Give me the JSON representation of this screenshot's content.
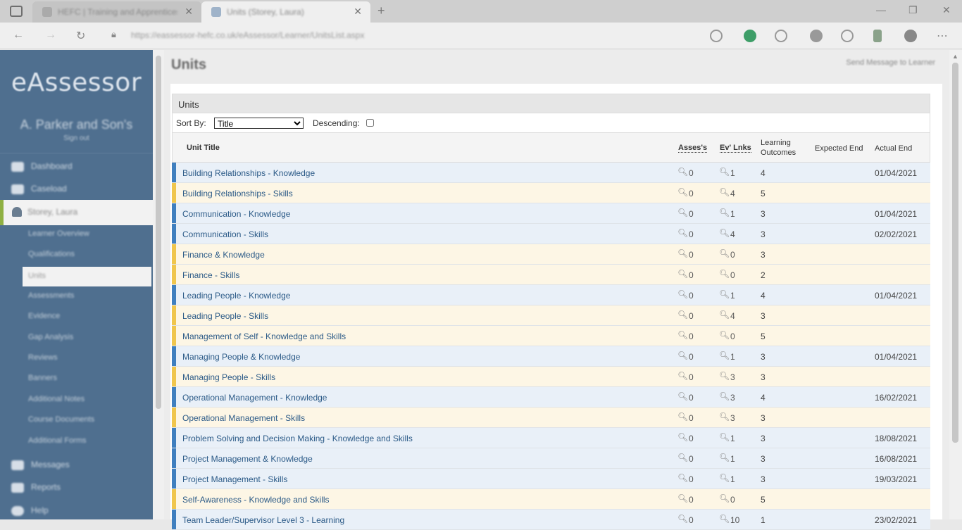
{
  "browser": {
    "tabs": [
      {
        "title": "HEFC | Training and Apprentices"
      },
      {
        "title": "Units (Storey, Laura)"
      }
    ],
    "url": "https://eassessor-hefc.co.uk/eAssessor/Learner/UnitsList.aspx"
  },
  "sidebar": {
    "brand": "eAssessor",
    "org": "A. Parker and Son's",
    "signout": "Sign out",
    "nav": [
      {
        "label": "Dashboard",
        "icon": "dashboard-icon"
      },
      {
        "label": "Caseload",
        "icon": "caseload-icon"
      }
    ],
    "active_learner": "Storey, Laura",
    "sub": [
      "Learner Overview",
      "Qualifications",
      "Units",
      "Assessments",
      "Evidence",
      "Gap Analysis",
      "Reviews",
      "Banners",
      "Additional Notes",
      "Course Documents",
      "Additional Forms"
    ],
    "nav_bottom": [
      {
        "label": "Messages",
        "icon": "envelope-icon"
      },
      {
        "label": "Reports",
        "icon": "chart-icon"
      },
      {
        "label": "Help",
        "icon": "help-icon"
      }
    ]
  },
  "main": {
    "page_title": "Units",
    "send_message": "Send Message to Learner",
    "panel_title": "Units",
    "sort_by_label": "Sort By:",
    "sort_by_value": "Title",
    "descending_label": "Descending:",
    "columns": {
      "title": "Unit Title",
      "asses": "Asses's",
      "ev": "Ev' Lnks",
      "lo1": "Learning",
      "lo2": "Outcomes",
      "expected": "Expected End",
      "actual": "Actual End"
    },
    "rows": [
      {
        "title": "Building Relationships - Knowledge",
        "color": "blue",
        "asses": "0",
        "ev": "1",
        "lo": "4",
        "actual": "01/04/2021"
      },
      {
        "title": "Building Relationships - Skills",
        "color": "yellow",
        "asses": "0",
        "ev": "4",
        "lo": "5",
        "actual": ""
      },
      {
        "title": "Communication - Knowledge",
        "color": "blue",
        "asses": "0",
        "ev": "1",
        "lo": "3",
        "actual": "01/04/2021"
      },
      {
        "title": "Communication - Skills",
        "color": "blue",
        "asses": "0",
        "ev": "4",
        "lo": "3",
        "actual": "02/02/2021"
      },
      {
        "title": "Finance & Knowledge",
        "color": "yellow",
        "asses": "0",
        "ev": "0",
        "lo": "3",
        "actual": ""
      },
      {
        "title": "Finance - Skills",
        "color": "yellow",
        "asses": "0",
        "ev": "0",
        "lo": "2",
        "actual": ""
      },
      {
        "title": "Leading People - Knowledge",
        "color": "blue",
        "asses": "0",
        "ev": "1",
        "lo": "4",
        "actual": "01/04/2021"
      },
      {
        "title": "Leading People - Skills",
        "color": "yellow",
        "asses": "0",
        "ev": "4",
        "lo": "3",
        "actual": ""
      },
      {
        "title": "Management of Self - Knowledge and Skills",
        "color": "yellow",
        "asses": "0",
        "ev": "0",
        "lo": "5",
        "actual": ""
      },
      {
        "title": "Managing People & Knowledge",
        "color": "blue",
        "asses": "0",
        "ev": "1",
        "lo": "3",
        "actual": "01/04/2021"
      },
      {
        "title": "Managing People - Skills",
        "color": "yellow",
        "asses": "0",
        "ev": "3",
        "lo": "3",
        "actual": ""
      },
      {
        "title": "Operational Management - Knowledge",
        "color": "blue",
        "asses": "0",
        "ev": "3",
        "lo": "4",
        "actual": "16/02/2021"
      },
      {
        "title": "Operational Management - Skills",
        "color": "yellow",
        "asses": "0",
        "ev": "3",
        "lo": "3",
        "actual": ""
      },
      {
        "title": "Problem Solving and Decision Making - Knowledge and Skills",
        "color": "blue",
        "asses": "0",
        "ev": "1",
        "lo": "3",
        "actual": "18/08/2021"
      },
      {
        "title": "Project Management & Knowledge",
        "color": "blue",
        "asses": "0",
        "ev": "1",
        "lo": "3",
        "actual": "16/08/2021"
      },
      {
        "title": "Project Management - Skills",
        "color": "blue",
        "asses": "0",
        "ev": "1",
        "lo": "3",
        "actual": "19/03/2021"
      },
      {
        "title": "Self-Awareness - Knowledge and Skills",
        "color": "yellow",
        "asses": "0",
        "ev": "0",
        "lo": "5",
        "actual": ""
      },
      {
        "title": "Team Leader/Supervisor Level 3 - Learning",
        "color": "blue",
        "asses": "0",
        "ev": "10",
        "lo": "1",
        "actual": "23/02/2021"
      }
    ]
  }
}
